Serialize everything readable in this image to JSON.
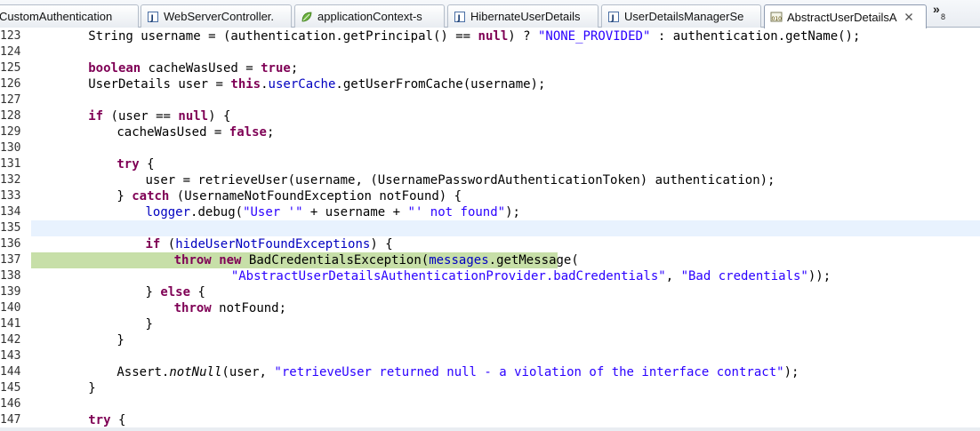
{
  "tabs": [
    {
      "label": "CustomAuthentication",
      "icon": "none",
      "active": false
    },
    {
      "label": "WebServerController.",
      "icon": "java-file-icon",
      "active": false
    },
    {
      "label": "applicationContext-s",
      "icon": "spring-leaf-icon",
      "active": false
    },
    {
      "label": "HibernateUserDetails",
      "icon": "java-file-icon",
      "active": false
    },
    {
      "label": "UserDetailsManagerSe",
      "icon": "java-file-icon",
      "active": false
    },
    {
      "label": "AbstractUserDetailsA",
      "icon": "class-file-icon",
      "active": true
    }
  ],
  "overflow": {
    "chevron": "»",
    "count": "8"
  },
  "lines": [
    {
      "n": "123",
      "indent": 8,
      "tokens": [
        [
          "p",
          "String username = (authentication.getPrincipal() == "
        ],
        [
          "k",
          "null"
        ],
        [
          "p",
          ") ? "
        ],
        [
          "s",
          "\"NONE_PROVIDED\""
        ],
        [
          "p",
          " : authentication.getName();"
        ]
      ]
    },
    {
      "n": "124",
      "indent": 0,
      "tokens": []
    },
    {
      "n": "125",
      "indent": 8,
      "tokens": [
        [
          "k",
          "boolean"
        ],
        [
          "p",
          " cacheWasUsed = "
        ],
        [
          "k",
          "true"
        ],
        [
          "p",
          ";"
        ]
      ]
    },
    {
      "n": "126",
      "indent": 8,
      "tokens": [
        [
          "p",
          "UserDetails user = "
        ],
        [
          "k",
          "this"
        ],
        [
          "p",
          "."
        ],
        [
          "f",
          "userCache"
        ],
        [
          "p",
          ".getUserFromCache(username);"
        ]
      ]
    },
    {
      "n": "127",
      "indent": 0,
      "tokens": []
    },
    {
      "n": "128",
      "indent": 8,
      "tokens": [
        [
          "k",
          "if"
        ],
        [
          "p",
          " (user == "
        ],
        [
          "k",
          "null"
        ],
        [
          "p",
          ") {"
        ]
      ]
    },
    {
      "n": "129",
      "indent": 12,
      "tokens": [
        [
          "p",
          "cacheWasUsed = "
        ],
        [
          "k",
          "false"
        ],
        [
          "p",
          ";"
        ]
      ]
    },
    {
      "n": "130",
      "indent": 0,
      "tokens": []
    },
    {
      "n": "131",
      "indent": 12,
      "tokens": [
        [
          "k",
          "try"
        ],
        [
          "p",
          " {"
        ]
      ]
    },
    {
      "n": "132",
      "indent": 16,
      "tokens": [
        [
          "p",
          "user = retrieveUser(username, (UsernamePasswordAuthenticationToken) authentication);"
        ]
      ]
    },
    {
      "n": "133",
      "indent": 12,
      "tokens": [
        [
          "p",
          "} "
        ],
        [
          "k",
          "catch"
        ],
        [
          "p",
          " (UsernameNotFoundException notFound) {"
        ]
      ]
    },
    {
      "n": "134",
      "indent": 16,
      "tokens": [
        [
          "f",
          "logger"
        ],
        [
          "p",
          ".debug("
        ],
        [
          "s",
          "\"User '\""
        ],
        [
          "p",
          " + username + "
        ],
        [
          "s",
          "\"' not found\""
        ],
        [
          "p",
          ");"
        ]
      ]
    },
    {
      "n": "135",
      "indent": 0,
      "tokens": [],
      "highlight": "current"
    },
    {
      "n": "136",
      "indent": 16,
      "tokens": [
        [
          "k",
          "if"
        ],
        [
          "p",
          " ("
        ],
        [
          "f",
          "hideUserNotFoundExceptions"
        ],
        [
          "p",
          ") {"
        ]
      ]
    },
    {
      "n": "137",
      "indent": 20,
      "tokens": [
        [
          "k",
          "throw"
        ],
        [
          "p",
          " "
        ],
        [
          "k",
          "new"
        ],
        [
          "p",
          " BadCredentialsException("
        ],
        [
          "f",
          "messages"
        ],
        [
          "p",
          ".getMessage("
        ]
      ],
      "highlight": "debug"
    },
    {
      "n": "138",
      "indent": 28,
      "tokens": [
        [
          "s",
          "\"AbstractUserDetailsAuthenticationProvider.badCredentials\""
        ],
        [
          "p",
          ", "
        ],
        [
          "s",
          "\"Bad credentials\""
        ],
        [
          "p",
          "));"
        ]
      ]
    },
    {
      "n": "139",
      "indent": 16,
      "tokens": [
        [
          "p",
          "} "
        ],
        [
          "k",
          "else"
        ],
        [
          "p",
          " {"
        ]
      ]
    },
    {
      "n": "140",
      "indent": 20,
      "tokens": [
        [
          "k",
          "throw"
        ],
        [
          "p",
          " notFound;"
        ]
      ]
    },
    {
      "n": "141",
      "indent": 16,
      "tokens": [
        [
          "p",
          "}"
        ]
      ]
    },
    {
      "n": "142",
      "indent": 12,
      "tokens": [
        [
          "p",
          "}"
        ]
      ]
    },
    {
      "n": "143",
      "indent": 0,
      "tokens": []
    },
    {
      "n": "144",
      "indent": 12,
      "tokens": [
        [
          "p",
          "Assert."
        ],
        [
          "i",
          "notNull"
        ],
        [
          "p",
          "(user, "
        ],
        [
          "s",
          "\"retrieveUser returned null - a violation of the interface contract\""
        ],
        [
          "p",
          ");"
        ]
      ]
    },
    {
      "n": "145",
      "indent": 8,
      "tokens": [
        [
          "p",
          "}"
        ]
      ]
    },
    {
      "n": "146",
      "indent": 0,
      "tokens": []
    },
    {
      "n": "147",
      "indent": 8,
      "tokens": [
        [
          "k",
          "try"
        ],
        [
          "p",
          " {"
        ]
      ]
    }
  ]
}
